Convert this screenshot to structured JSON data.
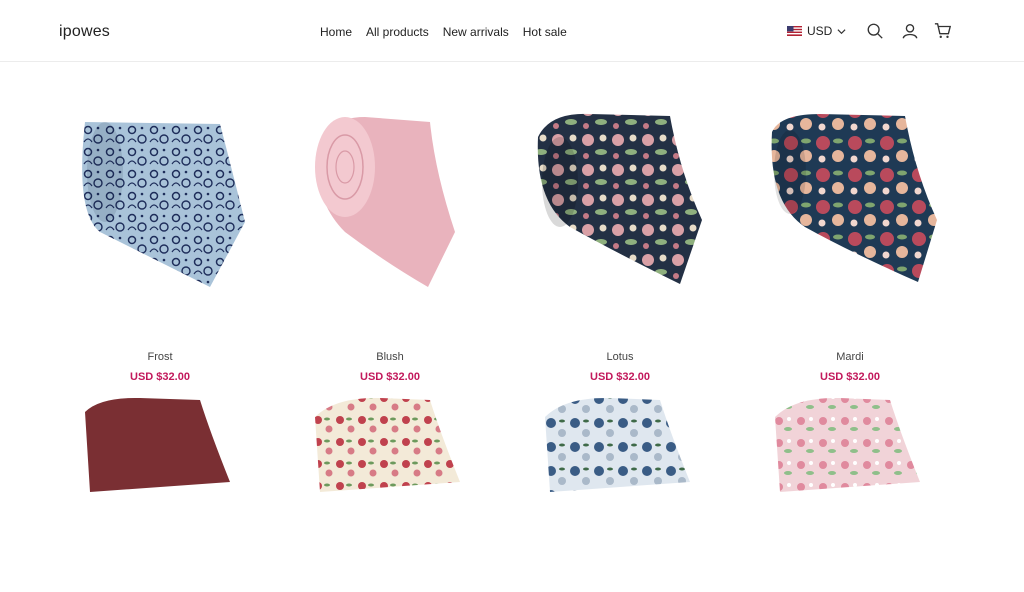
{
  "header": {
    "logo": "ipowes",
    "nav": [
      "Home",
      "All products",
      "New arrivals",
      "Hot sale"
    ],
    "currency": "USD",
    "icons": [
      "search-icon",
      "account-icon",
      "cart-icon"
    ]
  },
  "products": [
    {
      "name": "Frost",
      "price": "USD $32.00"
    },
    {
      "name": "Blush",
      "price": "USD $32.00"
    },
    {
      "name": "Lotus",
      "price": "USD $32.00"
    },
    {
      "name": "Mardi",
      "price": "USD $32.00"
    }
  ],
  "colors": {
    "price": "#c2185b",
    "border": "#ececec"
  }
}
